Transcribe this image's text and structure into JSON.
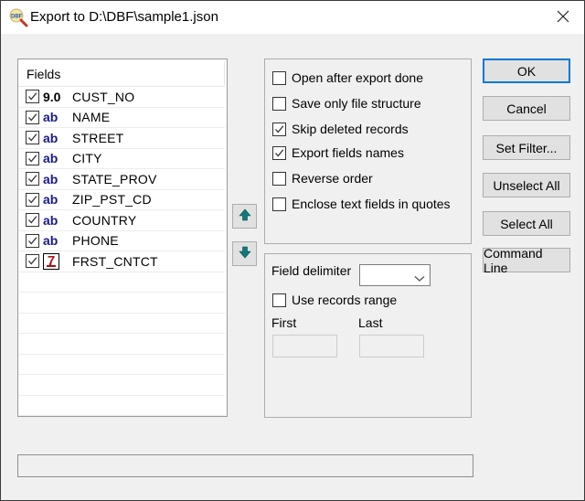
{
  "window": {
    "title": "Export to D:\\DBF\\sample1.json",
    "app_icon": "dbf-magnifier-icon",
    "close_icon": "close-icon"
  },
  "fields_list": {
    "header": "Fields",
    "items": [
      {
        "checked": true,
        "type": "numeric",
        "type_label": "9.0",
        "name": "CUST_NO"
      },
      {
        "checked": true,
        "type": "text",
        "type_label": "ab",
        "name": "NAME"
      },
      {
        "checked": true,
        "type": "text",
        "type_label": "ab",
        "name": "STREET"
      },
      {
        "checked": true,
        "type": "text",
        "type_label": "ab",
        "name": "CITY"
      },
      {
        "checked": true,
        "type": "text",
        "type_label": "ab",
        "name": "STATE_PROV"
      },
      {
        "checked": true,
        "type": "text",
        "type_label": "ab",
        "name": "ZIP_PST_CD"
      },
      {
        "checked": true,
        "type": "text",
        "type_label": "ab",
        "name": "COUNTRY"
      },
      {
        "checked": true,
        "type": "text",
        "type_label": "ab",
        "name": "PHONE"
      },
      {
        "checked": true,
        "type": "date",
        "type_label": "7",
        "name": "FRST_CNTCT"
      }
    ]
  },
  "move_buttons": {
    "up_icon": "arrow-up-icon",
    "down_icon": "arrow-down-icon"
  },
  "options": [
    {
      "label": "Open after export done",
      "checked": false
    },
    {
      "label": "Save only file structure",
      "checked": false
    },
    {
      "label": "Skip deleted records",
      "checked": true
    },
    {
      "label": "Export fields names",
      "checked": true
    },
    {
      "label": "Reverse order",
      "checked": false
    },
    {
      "label": "Enclose text fields in quotes",
      "checked": false
    }
  ],
  "delimiter_group": {
    "field_delimiter_label": "Field delimiter",
    "field_delimiter_value": "",
    "use_records_range_label": "Use records range",
    "use_records_range_checked": false,
    "first_label": "First",
    "first_value": "",
    "last_label": "Last",
    "last_value": ""
  },
  "buttons": {
    "ok": "OK",
    "cancel": "Cancel",
    "set_filter": "Set Filter...",
    "unselect_all": "Unselect All",
    "select_all": "Select All",
    "command_line": "Command Line"
  },
  "progress": {
    "value_percent": 0
  },
  "colors": {
    "accent": "#0078d7",
    "text_type": "#1a1a8c",
    "date_type": "#b01010",
    "arrow": "#0f7a7a"
  }
}
